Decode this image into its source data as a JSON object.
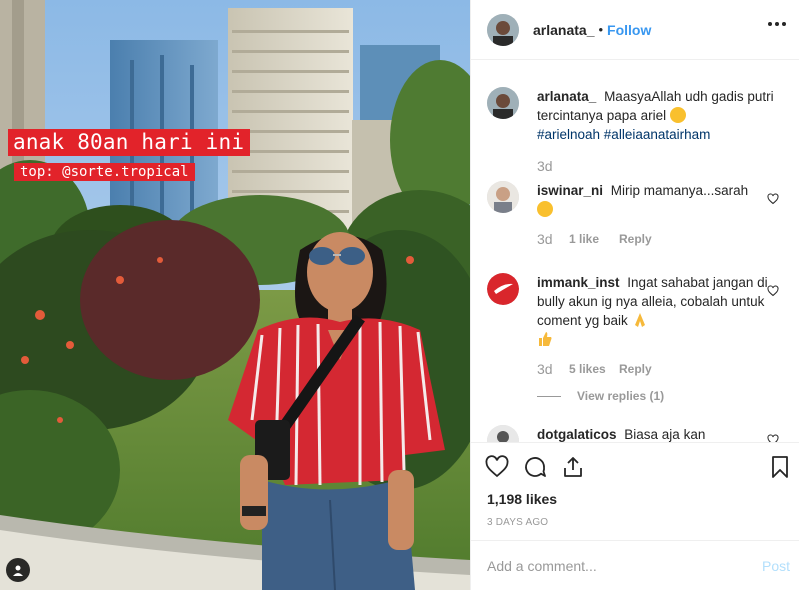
{
  "post": {
    "caption_overlay": "anak 80an hari ini",
    "caption_sub": "top: @sorte.tropical"
  },
  "header": {
    "username": "arlanata_",
    "separator": "•",
    "follow_label": "Follow"
  },
  "comments": [
    {
      "username": "arlanata_",
      "text": "MaasyaAllah udh gadis putri tercintanya papa ariel",
      "hashtags": "#arielnoah #alleiaanatairham",
      "time": "3d"
    },
    {
      "username": "iswinar_ni",
      "text": "Mirip mamanya...sarah",
      "time": "3d",
      "likes": "1 like",
      "reply": "Reply"
    },
    {
      "username": "immank_inst",
      "text": "Ingat sahabat jangan di bully akun ig nya alleia, cobalah untuk coment yg baik",
      "time": "3d",
      "likes": "5 likes",
      "reply": "Reply",
      "view_replies": "View replies (1)"
    },
    {
      "username": "dotgalaticos",
      "text": "Biasa aja kan"
    }
  ],
  "actions": {
    "likes": "1,198 likes",
    "posted_ago": "3 DAYS AGO"
  },
  "add_comment": {
    "placeholder": "Add a comment...",
    "post_label": "Post"
  },
  "icons": {
    "like": "heart-icon",
    "comment": "comment-icon",
    "share": "share-icon",
    "save": "bookmark-icon",
    "more": "more-options-icon",
    "tagged": "user-tag-icon"
  },
  "colors": {
    "link": "#3897f0",
    "hashtag": "#003569",
    "caption_bg": "#e2232a",
    "post_disabled": "#b2dffc"
  }
}
